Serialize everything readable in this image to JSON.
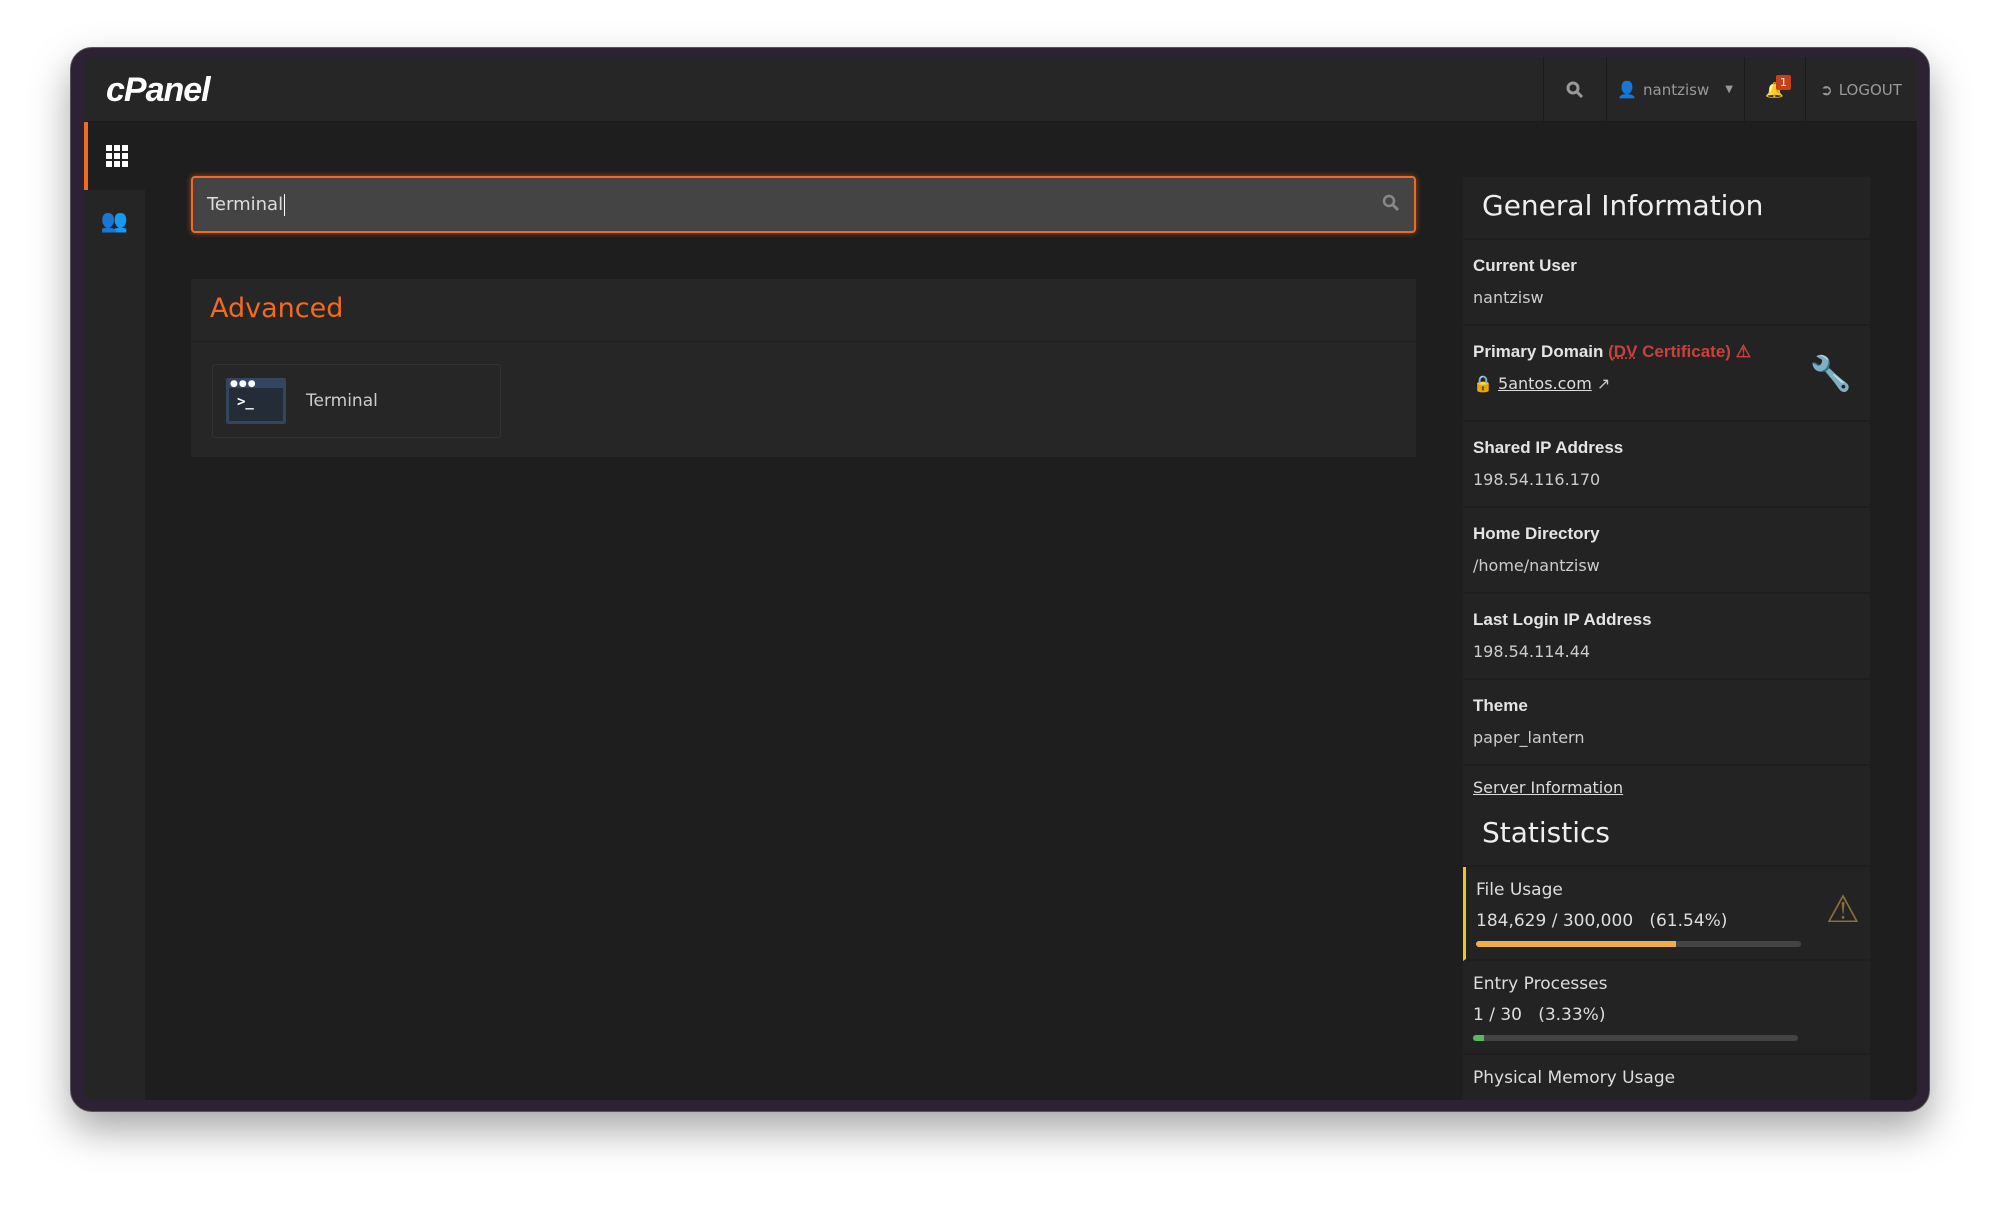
{
  "header": {
    "logo": "cPanel",
    "user": "nantzisw",
    "notifications": "1",
    "logout": "LOGOUT"
  },
  "search": {
    "value": "Terminal"
  },
  "results": {
    "section": "Advanced",
    "items": [
      {
        "label": "Terminal",
        "icon": "terminal-icon"
      }
    ]
  },
  "general": {
    "title": "General Information",
    "current_user_label": "Current User",
    "current_user": "nantzisw",
    "primary_domain_label": "Primary Domain",
    "cert_open": "(",
    "cert_abbr": "DV",
    "cert_rest": " Certificate)",
    "domain": "5antos.com",
    "shared_ip_label": "Shared IP Address",
    "shared_ip": "198.54.116.170",
    "home_label": "Home Directory",
    "home": "/home/nantzisw",
    "last_login_label": "Last Login IP Address",
    "last_login": "198.54.114.44",
    "theme_label": "Theme",
    "theme": "paper_lantern",
    "server_info": "Server Information"
  },
  "statistics": {
    "title": "Statistics",
    "items": [
      {
        "label": "File Usage",
        "value": "184,629 / 300,000   (61.54%)",
        "percent": 61.54,
        "color": "#f0ad4e",
        "warning": true
      },
      {
        "label": "Entry Processes",
        "value": "1 / 30   (3.33%)",
        "percent": 3.33,
        "color": "#5cb85c"
      },
      {
        "label": "Physical Memory Usage"
      }
    ]
  },
  "colors": {
    "accent": "#f26a21",
    "danger": "#c9413b",
    "warning": "#8a6d3b"
  }
}
